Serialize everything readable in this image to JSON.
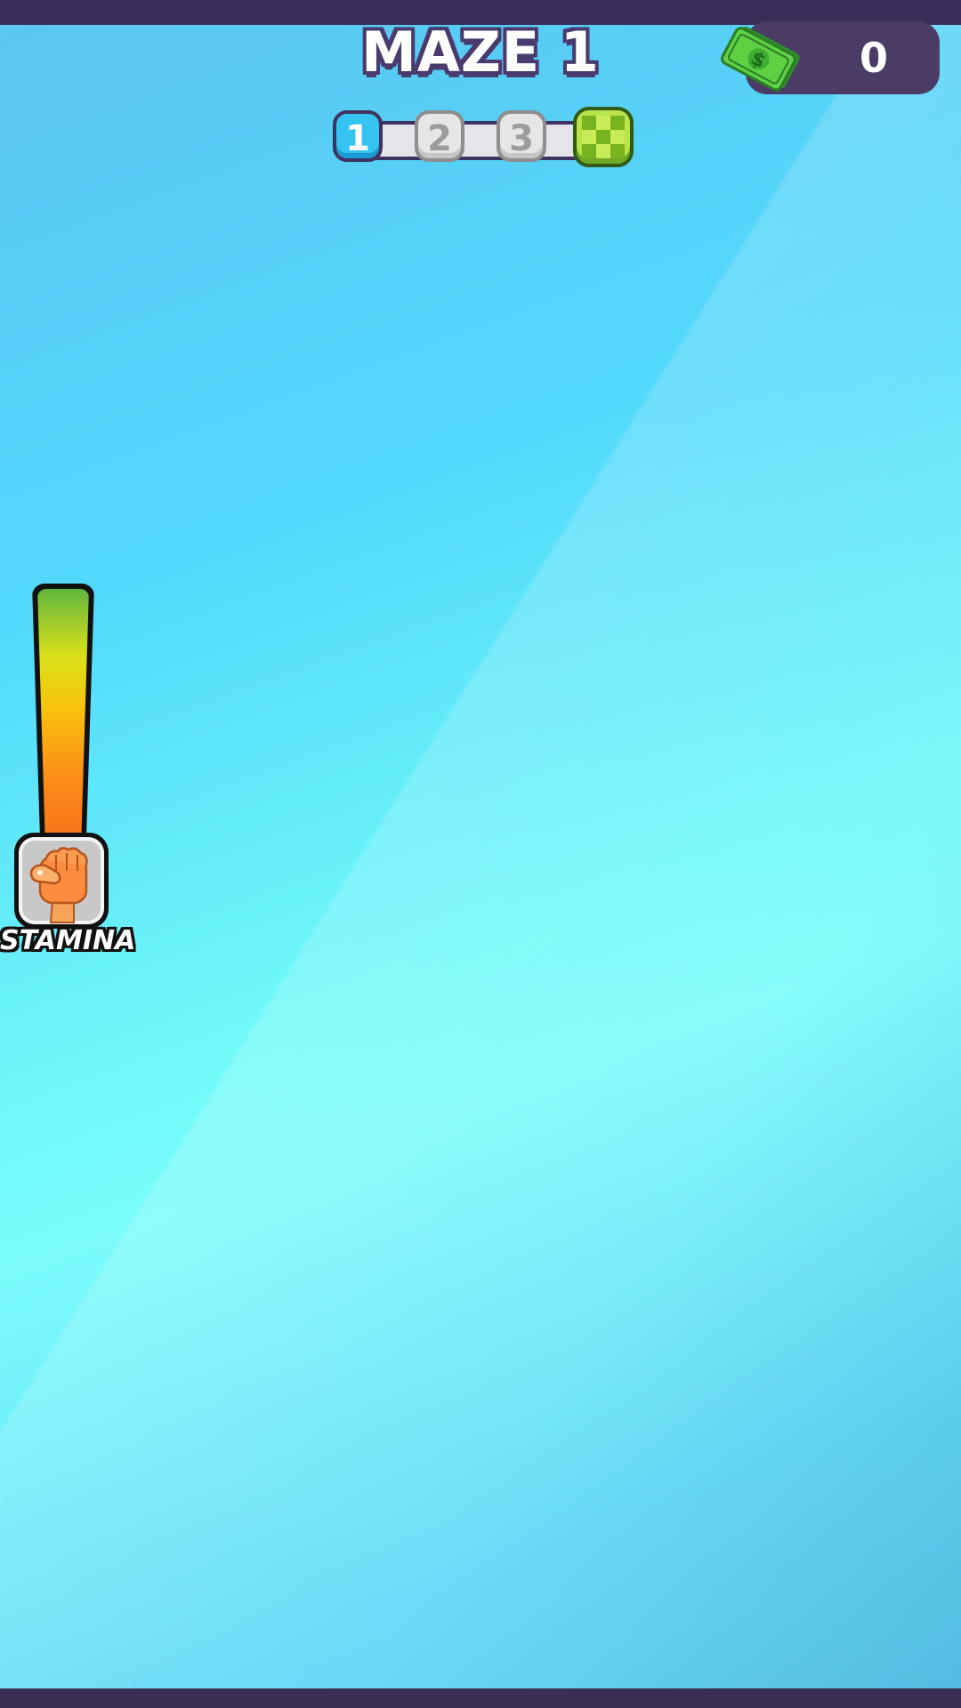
{
  "game": {
    "title": "MAZE 1",
    "currency": {
      "value": "0",
      "icon": "cash-icon"
    },
    "stages": [
      {
        "label": "1",
        "state": "current"
      },
      {
        "label": "2",
        "state": "locked"
      },
      {
        "label": "3",
        "state": "locked"
      },
      {
        "label": "",
        "state": "finish",
        "icon": "checkered-flag-icon"
      }
    ],
    "stamina": {
      "label": "STAMINA",
      "level": 1.0,
      "icon": "fist-icon"
    }
  },
  "colors": {
    "bar_dark": "#3b2d5a",
    "stage_active": "#35c4f2",
    "finish_green": "#b9e34a",
    "stamina_top": "#62b63d",
    "stamina_bottom": "#fa6d1d"
  }
}
